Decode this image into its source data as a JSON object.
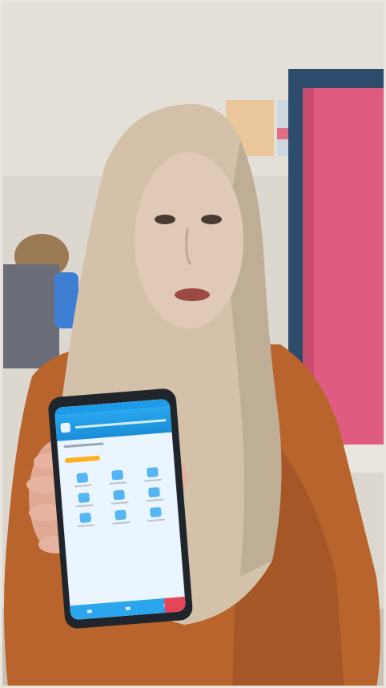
{
  "scene": {
    "colors": {
      "wall": "#dcd7cf",
      "curtain": "#df5b7f",
      "hijab": "#d3c1a9",
      "clothing": "#b9632d",
      "phone_frame": "#20252b",
      "app_blue": "#1e9be8",
      "app_red": "#e64558"
    }
  },
  "phone_app": {
    "grid_tile_count": 9
  }
}
